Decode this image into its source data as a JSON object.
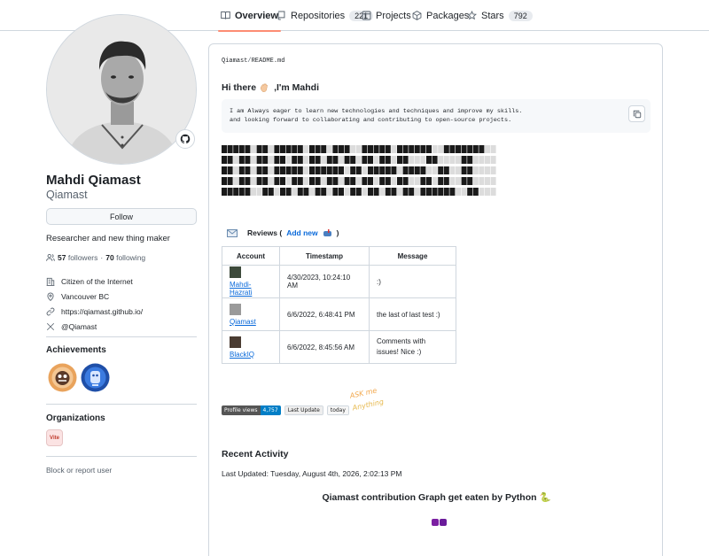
{
  "nav": {
    "tabs": [
      {
        "label": "Overview",
        "icon": "book-icon",
        "active": true
      },
      {
        "label": "Repositories",
        "icon": "repo-icon",
        "count": "221"
      },
      {
        "label": "Projects",
        "icon": "table-icon"
      },
      {
        "label": "Packages",
        "icon": "package-icon"
      },
      {
        "label": "Stars",
        "icon": "star-icon",
        "count": "792"
      }
    ]
  },
  "profile": {
    "name": "Mahdi Qiamast",
    "login": "Qiamast",
    "follow_label": "Follow",
    "bio": "Researcher and new thing maker",
    "followers_count": "57",
    "followers_label": "followers",
    "dot": "·",
    "following_count": "70",
    "following_label": "following",
    "company": "Citizen of the Internet",
    "location": "Vancouver BC",
    "website": "https://qiamast.github.io/",
    "social": "@Qiamast",
    "status_emoji": "octocat-icon"
  },
  "achievements": {
    "title": "Achievements",
    "items": [
      "pull-shark-icon",
      "yolo-icon"
    ]
  },
  "organizations": {
    "title": "Organizations",
    "items": [
      {
        "abbr": "Vite"
      }
    ]
  },
  "block_label": "Block or report user",
  "readme": {
    "owner": "Qiamast",
    "sep": "/",
    "file": "README.md",
    "greeting_pre": "Hi there",
    "greeting_post": ",I'm Mahdi",
    "code_line1": "I am Always eager to learn new technologies and techniques and improve my skills.",
    "code_line2": "and looking forward to collaborating and contributing to open-source projects.",
    "reviews": {
      "label": "Reviews (",
      "link": "Add new",
      "close": ")",
      "headers": [
        "Account",
        "Timestamp",
        "Message"
      ],
      "rows": [
        {
          "user": "Mahdi-Hazrati",
          "time": "4/30/2023, 10:24:10 AM",
          "msg": ":)"
        },
        {
          "user": "Qiamast",
          "time": "6/6/2022, 6:48:41 PM",
          "msg": "the last of last test :)"
        },
        {
          "user": "BlackIQ",
          "time": "6/6/2022, 8:45:56 AM",
          "msg": "Comments with issues! Nice :)"
        }
      ]
    },
    "badges": {
      "views_label": "Profile views",
      "views_value": "4,757",
      "last_update_label": "Last Update",
      "last_update_value": "today"
    },
    "askme_text": "ASK me Anything",
    "recent_title": "Recent Activity",
    "last_updated": "Last Updated: Tuesday, August 4th, 2026, 2:02:13 PM",
    "graph_title": "Qiamast contribution Graph get eaten by Python 🐍"
  },
  "colors": {
    "accent": "#fd8c73",
    "link": "#0969da",
    "border": "#d0d7de",
    "muted": "#59636e",
    "views_badge": "#007ec6",
    "snake": "#7b1fa2"
  }
}
